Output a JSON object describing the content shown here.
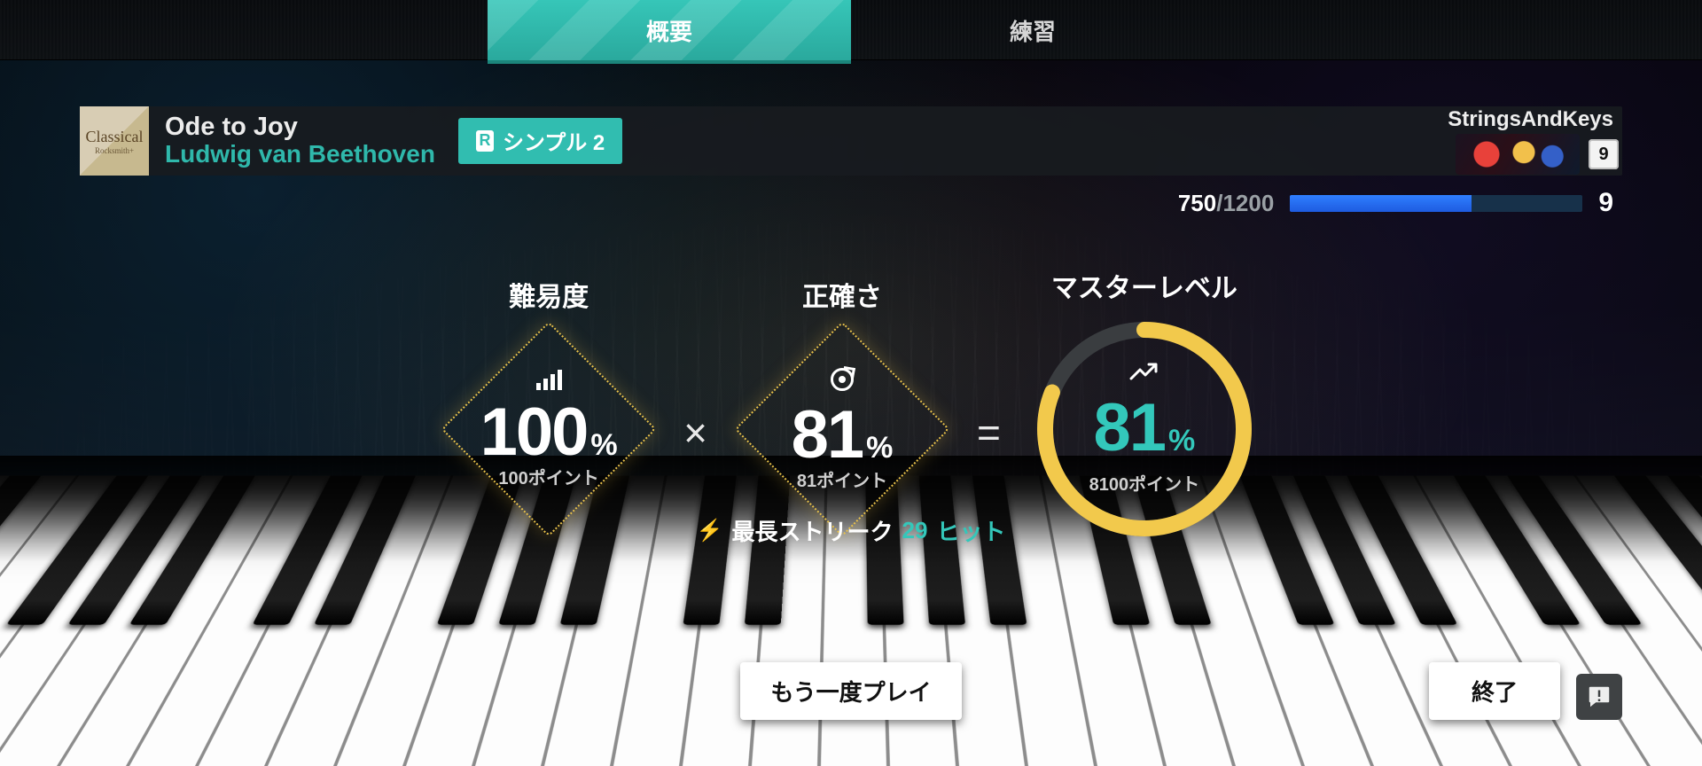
{
  "tabs": {
    "overview": "概要",
    "practice": "練習"
  },
  "song": {
    "album_label": "Classical",
    "album_sub": "Rocksmith+",
    "title": "Ode to Joy",
    "artist": "Ludwig van Beethoven",
    "difficulty_badge": "シンプル 2"
  },
  "player": {
    "name": "StringsAndKeys",
    "level": "9"
  },
  "xp": {
    "current": "750",
    "max": "1200",
    "fill_pct": 62,
    "target_level": "9"
  },
  "stats": {
    "difficulty": {
      "label": "難易度",
      "value": "100",
      "pct": "%",
      "sub": "100ポイント"
    },
    "accuracy": {
      "label": "正確さ",
      "value": "81",
      "pct": "%",
      "sub": "81ポイント"
    },
    "mastery": {
      "label": "マスターレベル",
      "value": "81",
      "pct": "%",
      "sub": "8100ポイント",
      "ring_pct": 81
    },
    "op_times": "×",
    "op_eq": "="
  },
  "streak": {
    "label": "最長ストリーク",
    "value": "29",
    "unit": "ヒット"
  },
  "buttons": {
    "play_again": "もう一度プレイ",
    "quit": "終了"
  }
}
